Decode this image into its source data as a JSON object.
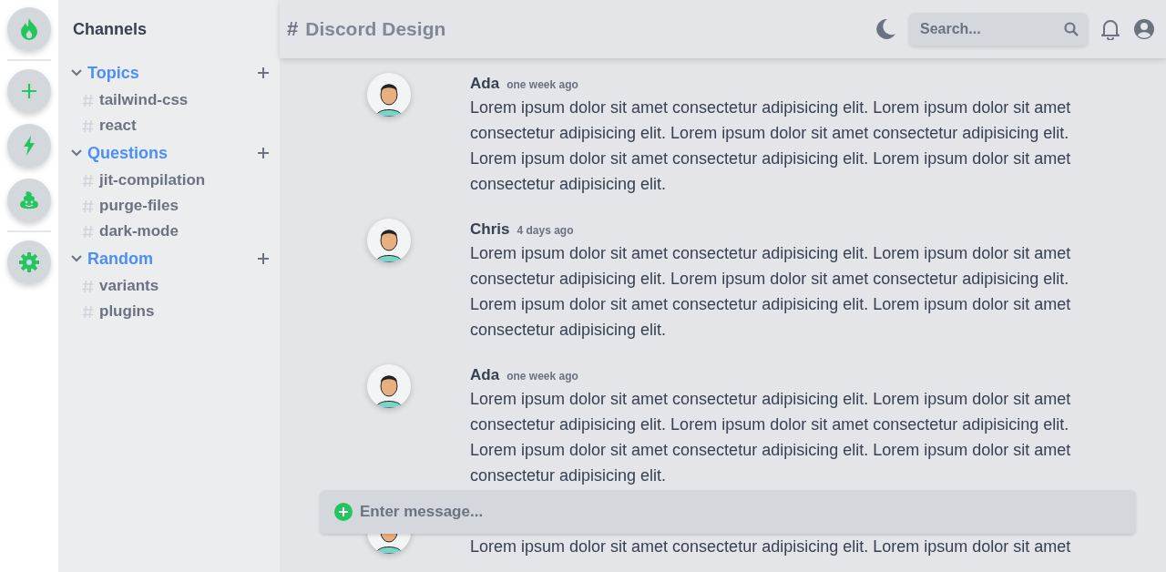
{
  "servers": [
    {
      "kind": "flame"
    },
    {
      "kind": "plus"
    },
    {
      "kind": "bolt"
    },
    {
      "kind": "blob"
    },
    {
      "kind": "gear"
    }
  ],
  "sidebar": {
    "title": "Channels",
    "groups": [
      {
        "label": "Topics",
        "expanded": true,
        "channels": [
          "tailwind-css",
          "react"
        ]
      },
      {
        "label": "Questions",
        "expanded": true,
        "channels": [
          "jit-compilation",
          "purge-files",
          "dark-mode"
        ]
      },
      {
        "label": "Random",
        "expanded": true,
        "channels": [
          "variants",
          "plugins"
        ]
      }
    ]
  },
  "header": {
    "hash": "#",
    "title": "Discord Design",
    "search": {
      "placeholder": "Search..."
    }
  },
  "messages": [
    {
      "author": "Ada",
      "time": "one week ago",
      "body": "Lorem ipsum dolor sit amet consectetur adipisicing elit. Lorem ipsum dolor sit amet consectetur adipisicing elit. Lorem ipsum dolor sit amet consectetur adipisicing elit. Lorem ipsum dolor sit amet consectetur adipisicing elit. Lorem ipsum dolor sit amet consectetur adipisicing elit."
    },
    {
      "author": "Chris",
      "time": "4 days ago",
      "body": "Lorem ipsum dolor sit amet consectetur adipisicing elit. Lorem ipsum dolor sit amet consectetur adipisicing elit. Lorem ipsum dolor sit amet consectetur adipisicing elit. Lorem ipsum dolor sit amet consectetur adipisicing elit. Lorem ipsum dolor sit amet consectetur adipisicing elit."
    },
    {
      "author": "Ada",
      "time": "one week ago",
      "body": "Lorem ipsum dolor sit amet consectetur adipisicing elit. Lorem ipsum dolor sit amet consectetur adipisicing elit. Lorem ipsum dolor sit amet consectetur adipisicing elit. Lorem ipsum dolor sit amet consectetur adipisicing elit. Lorem ipsum dolor sit amet consectetur adipisicing elit."
    },
    {
      "body": "Lorem ipsum dolor sit amet consectetur adipisicing elit. Lorem ipsum dolor sit amet"
    }
  ],
  "composer": {
    "placeholder": "Enter message..."
  }
}
